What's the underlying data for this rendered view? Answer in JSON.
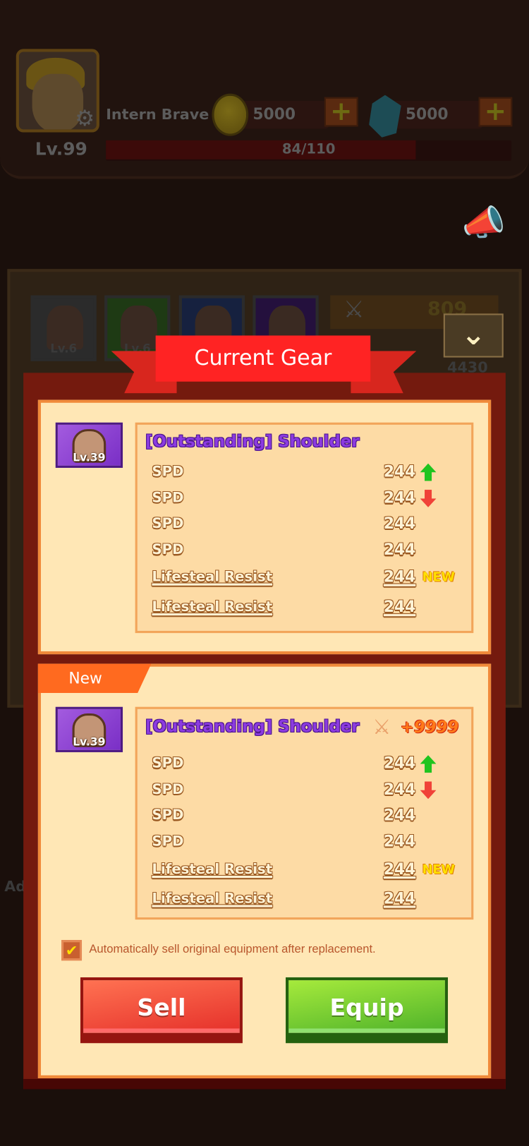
{
  "header": {
    "player_name": "Intern Brave",
    "level": "Lv.99",
    "gold": "5000",
    "gems": "5000",
    "xp_text": "84/110",
    "xp_fraction": 0.764
  },
  "background": {
    "slots": [
      {
        "level": "Lv.6",
        "color": "#2b2b2b"
      },
      {
        "level": "Lv.6",
        "color": "#1e3a14"
      },
      {
        "level": "",
        "color": "#16213f"
      },
      {
        "level": "",
        "color": "#24103d"
      }
    ],
    "power": "809",
    "stat_total": "4430",
    "side_label_left": "Ad"
  },
  "modal": {
    "title": "Current Gear",
    "current": {
      "item_level": "Lv.39",
      "item_name": "[Outstanding] Shoulder",
      "stats": [
        {
          "name": "SPD",
          "value": "244",
          "indicator": "up"
        },
        {
          "name": "SPD",
          "value": "244",
          "indicator": "down"
        },
        {
          "name": "SPD",
          "value": "244",
          "indicator": ""
        },
        {
          "name": "SPD",
          "value": "244",
          "indicator": ""
        },
        {
          "name": "Lifesteal Resist",
          "value": "244",
          "indicator": "new"
        },
        {
          "name": "Lifesteal Resist",
          "value": "244",
          "indicator": ""
        }
      ]
    },
    "new_tag": "New",
    "new_item": {
      "item_level": "Lv.39",
      "item_name": "[Outstanding] Shoulder",
      "power_change": "+9999",
      "stats": [
        {
          "name": "SPD",
          "value": "244",
          "indicator": "up"
        },
        {
          "name": "SPD",
          "value": "244",
          "indicator": "down"
        },
        {
          "name": "SPD",
          "value": "244",
          "indicator": ""
        },
        {
          "name": "SPD",
          "value": "244",
          "indicator": ""
        },
        {
          "name": "Lifesteal Resist",
          "value": "244",
          "indicator": "new"
        },
        {
          "name": "Lifesteal Resist",
          "value": "244",
          "indicator": ""
        }
      ]
    },
    "new_label": "NEW",
    "auto_sell_checked": true,
    "auto_sell_label": "Automatically sell original equipment after replacement.",
    "sell_label": "Sell",
    "equip_label": "Equip"
  }
}
